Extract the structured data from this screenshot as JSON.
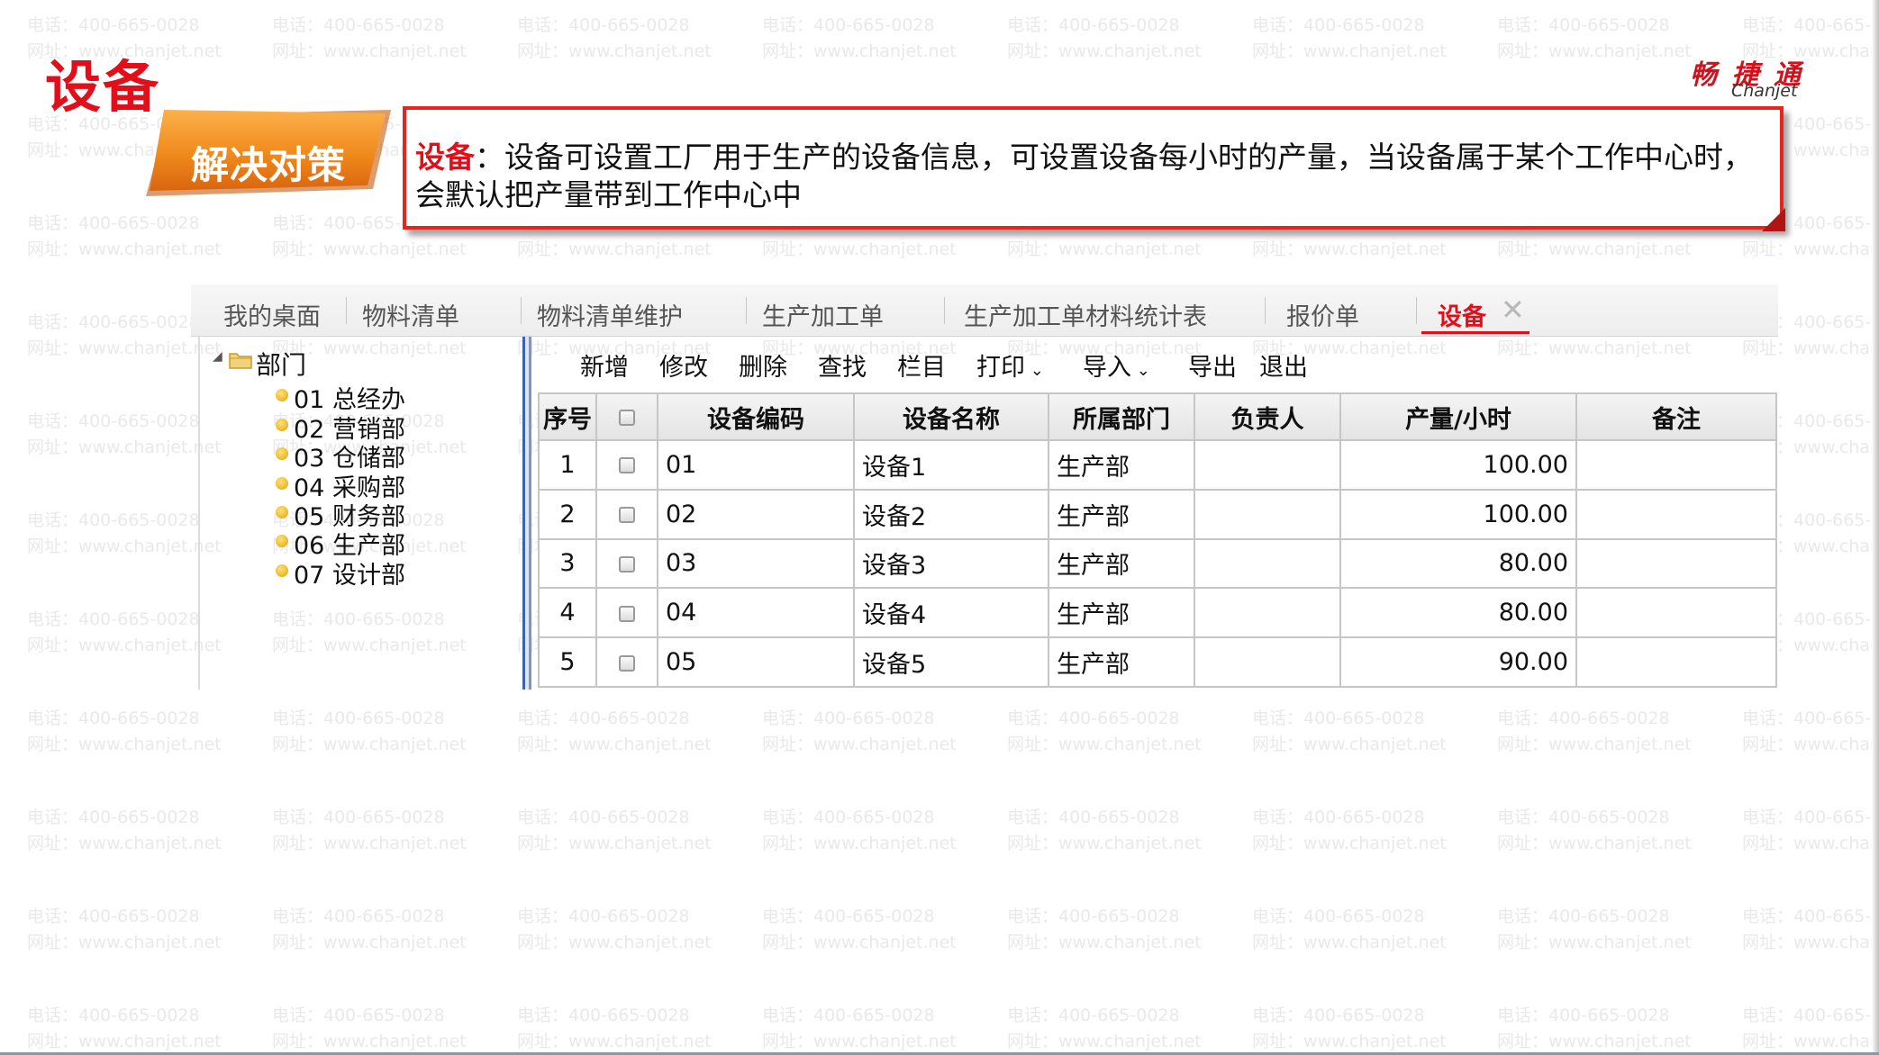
{
  "watermark": {
    "phone": "电话：400-665-0028",
    "site": "网址：www.chanjet.net"
  },
  "page_title": "设备",
  "brand": {
    "name_cn": "畅 捷 通",
    "name_en": "Chanjet",
    "color": "#d2111d"
  },
  "badge": {
    "label": "解决对策",
    "color": "#f08a1c"
  },
  "description": {
    "keyword": "设备",
    "text": "：设备可设置工厂用于生产的设备信息，可设置设备每小时的产量，当设备属于某个工作中心时，会默认把产量带到工作中心中"
  },
  "tabs": [
    {
      "label": "我的桌面"
    },
    {
      "label": "物料清单"
    },
    {
      "label": "物料清单维护"
    },
    {
      "label": "生产加工单"
    },
    {
      "label": "生产加工单材料统计表"
    },
    {
      "label": "报价单"
    },
    {
      "label": "设备",
      "active": true
    }
  ],
  "tree": {
    "root": "部门",
    "items": [
      "01 总经办",
      "02 营销部",
      "03 仓储部",
      "04 采购部",
      "05 财务部",
      "06 生产部",
      "07 设计部"
    ]
  },
  "toolbar": {
    "add": "新增",
    "edit": "修改",
    "delete": "删除",
    "find": "查找",
    "columns": "栏目",
    "print": "打印",
    "import": "导入",
    "export": "导出",
    "exit": "退出"
  },
  "grid": {
    "headers": [
      "序号",
      "",
      "设备编码",
      "设备名称",
      "所属部门",
      "负责人",
      "产量/小时",
      "备注"
    ],
    "rows": [
      [
        "1",
        "",
        "01",
        "设备1",
        "生产部",
        "",
        "100.00",
        ""
      ],
      [
        "2",
        "",
        "02",
        "设备2",
        "生产部",
        "",
        "100.00",
        ""
      ],
      [
        "3",
        "",
        "03",
        "设备3",
        "生产部",
        "",
        "80.00",
        ""
      ],
      [
        "4",
        "",
        "04",
        "设备4",
        "生产部",
        "",
        "80.00",
        ""
      ],
      [
        "5",
        "",
        "05",
        "设备5",
        "生产部",
        "",
        "90.00",
        ""
      ]
    ]
  },
  "colors": {
    "accent_red": "#e20f1a",
    "box_border": "#e8241c",
    "splitter_blue": "#3d64a8"
  }
}
